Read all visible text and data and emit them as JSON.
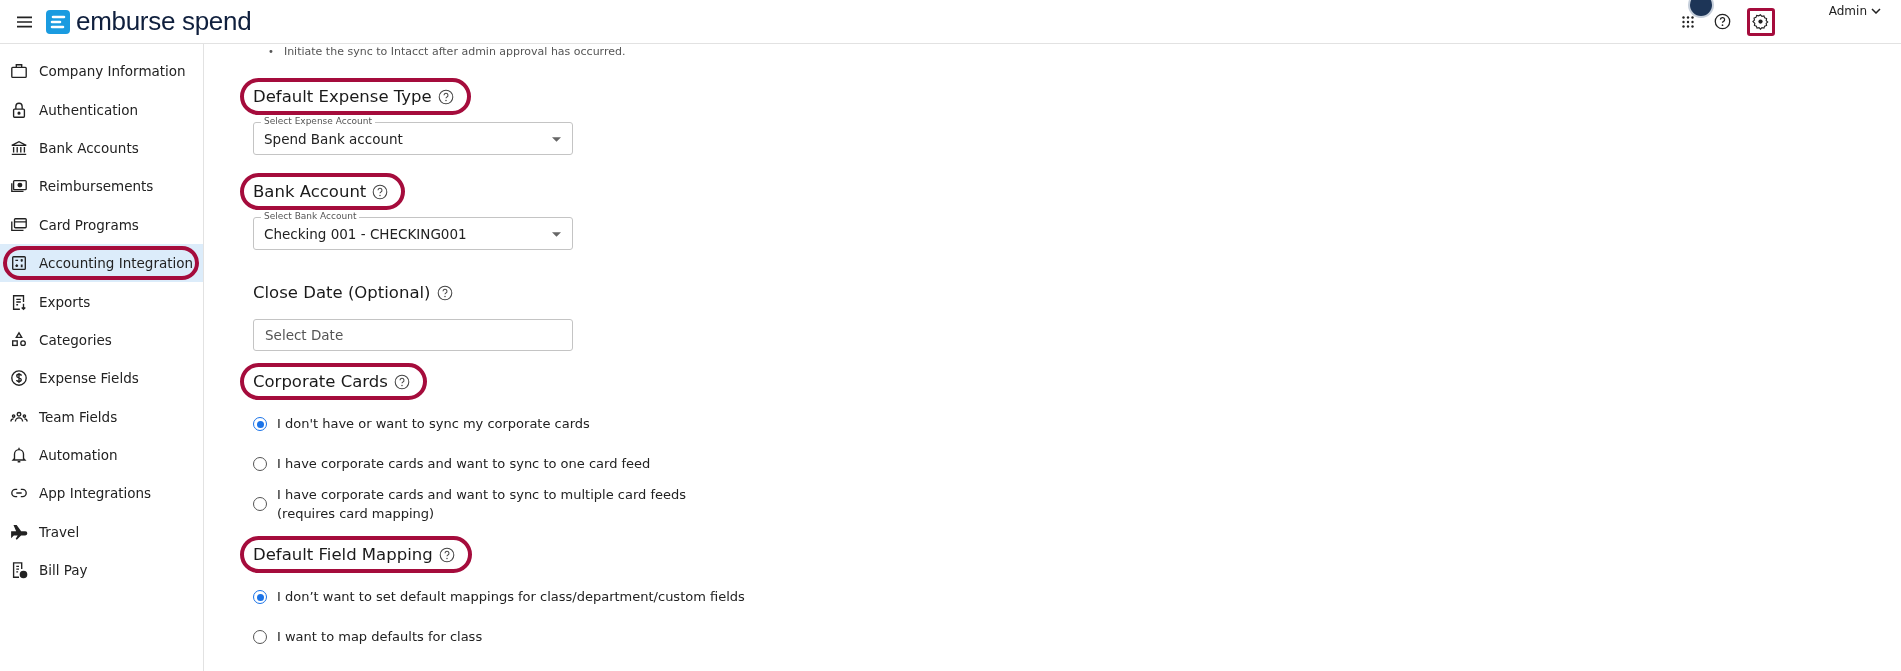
{
  "header": {
    "logo_text": "emburse spend",
    "user": "Admin",
    "settings_highlighted": true
  },
  "sidebar": {
    "items": [
      {
        "label": "Company Information",
        "selected": false,
        "highlighted": false
      },
      {
        "label": "Authentication",
        "selected": false,
        "highlighted": false
      },
      {
        "label": "Bank Accounts",
        "selected": false,
        "highlighted": false
      },
      {
        "label": "Reimbursements",
        "selected": false,
        "highlighted": false
      },
      {
        "label": "Card Programs",
        "selected": false,
        "highlighted": false
      },
      {
        "label": "Accounting Integration",
        "selected": true,
        "highlighted": true
      },
      {
        "label": "Exports",
        "selected": false,
        "highlighted": false
      },
      {
        "label": "Categories",
        "selected": false,
        "highlighted": false
      },
      {
        "label": "Expense Fields",
        "selected": false,
        "highlighted": false
      },
      {
        "label": "Team Fields",
        "selected": false,
        "highlighted": false
      },
      {
        "label": "Automation",
        "selected": false,
        "highlighted": false
      },
      {
        "label": "App Integrations",
        "selected": false,
        "highlighted": false
      },
      {
        "label": "Travel",
        "selected": false,
        "highlighted": false
      },
      {
        "label": "Bill Pay",
        "selected": false,
        "highlighted": false
      }
    ]
  },
  "content": {
    "note_bullet": "•",
    "note": "Initiate the sync to Intacct after admin approval has occurred.",
    "sections": [
      {
        "kind": "select",
        "title": "Default Expense Type",
        "help": true,
        "highlighted": true,
        "field": {
          "label": "Select Expense Account",
          "value": "Spend Bank account"
        }
      },
      {
        "kind": "select",
        "title": "Bank Account",
        "help": true,
        "highlighted": true,
        "field": {
          "label": "Select Bank Account",
          "value": "Checking 001 - CHECKING001"
        }
      },
      {
        "kind": "date",
        "title": "Close Date (Optional)",
        "help": true,
        "highlighted": false,
        "field": {
          "placeholder": "Select Date"
        }
      },
      {
        "kind": "radio",
        "title": "Corporate Cards",
        "help": true,
        "highlighted": true,
        "options": [
          {
            "label": "I don't have or want to sync my corporate cards",
            "selected": true
          },
          {
            "label": "I have corporate cards and want to sync to one card feed",
            "selected": false
          },
          {
            "label": "I have corporate cards and want to sync to multiple card feeds (requires card mapping)",
            "selected": false
          }
        ]
      },
      {
        "kind": "radio",
        "title": "Default Field Mapping",
        "help": true,
        "highlighted": true,
        "options": [
          {
            "label": "I don’t want to set default mappings for class/department/custom fields",
            "selected": true
          },
          {
            "label": "I want to map defaults for class",
            "selected": false
          }
        ]
      }
    ]
  }
}
